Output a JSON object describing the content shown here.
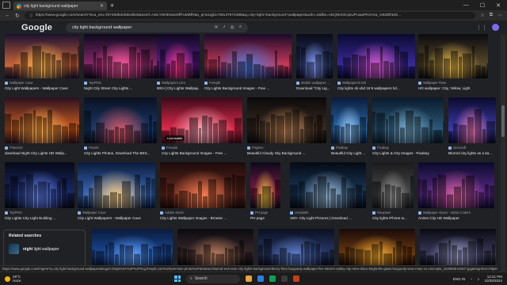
{
  "browser": {
    "tab_title": "city light background wallpaper",
    "url": "https://www.google.com/search?sca_esv=f5749d53eb8ed946&sxsrf=ADLYWIIK6we5ffTuMBfN5a_qHx1qjk1738137874485&q=city+light+background+wallpaper&udm=2&fbs=AEQNm0CqsUPuwaPKrHXa_U82Dlf4dS..."
  },
  "google": {
    "logo": "Google",
    "query": "city light background wallpaper"
  },
  "results": [
    {
      "source": "Wallpaper Cave",
      "caption": "City Light Wallpapers - Wallpaper Cave",
      "colors": [
        "#1a1030",
        "#c8643a",
        "#f7b44c"
      ]
    },
    {
      "source": "TopPNG",
      "caption": "Night City Street City Lights ...",
      "colors": [
        "#0c0a1e",
        "#8a2a6a",
        "#ff5aa0"
      ]
    },
    {
      "source": "Wallpapers.com",
      "caption": "900+] City Lights Wallpap...",
      "colors": [
        "#100820",
        "#5a1f8a",
        "#ff3a8a"
      ]
    },
    {
      "source": "Freepik",
      "caption": "City Lights Background Images - Free ...",
      "colors": [
        "#1a0a2a",
        "#c83a5a",
        "#4a7adf"
      ]
    },
    {
      "source": "Mobile wallpaper ...",
      "caption": "Download \"City Lig...",
      "colors": [
        "#0a0a18",
        "#2a3a6a",
        "#8aa0ff"
      ]
    },
    {
      "source": "WallpapersCraft",
      "caption": "City lights 4k uhd 16:9 wallpapers hd...",
      "colors": [
        "#0a0a30",
        "#3a2a9a",
        "#e05ad0"
      ]
    },
    {
      "source": "Wallpaper Flare",
      "caption": "HD wallpaper: City, Yellow, Light",
      "colors": [
        "#0a0a10",
        "#5a4a2a",
        "#f0c050"
      ]
    },
    {
      "source": "Pinterest",
      "caption": "download Night City Lights HD Wallp...",
      "colors": [
        "#2a1020",
        "#d06020",
        "#ffb050"
      ]
    },
    {
      "source": "Pexels",
      "caption": "City Lights Photos, Download The BES...",
      "colors": [
        "#0a1020",
        "#1a3a6a",
        "#e05a6a"
      ]
    },
    {
      "source": "Freepik",
      "caption": "City Lights Background Images - Free ...",
      "colors": [
        "#3a0a1a",
        "#e02a4a",
        "#ffb0c0"
      ]
    },
    {
      "source": "Pngtree",
      "caption": "Beautiful Cloudy Sky Background ...",
      "colors": [
        "#0a0a0a",
        "#3a2a20",
        "#d09060"
      ]
    },
    {
      "source": "Pixabay",
      "caption": "Beautiful City Light ...",
      "colors": [
        "#0a1a3a",
        "#2a6aaa",
        "#a0d0ff"
      ]
    },
    {
      "source": "Pixabay",
      "caption": "City Lights & City Images - Pixabay",
      "colors": [
        "#0a1a2a",
        "#2a5a7a",
        "#7ab0d0"
      ]
    },
    {
      "source": "Gencraft",
      "caption": "Blurred city lights as a ba...",
      "colors": [
        "#0a0a2a",
        "#3a3aaa",
        "#ff80c0"
      ]
    },
    {
      "source": "TopPNG",
      "caption": "City Lights City Light Building ...",
      "colors": [
        "#060a18",
        "#1a2a6a",
        "#6a8aff"
      ]
    },
    {
      "source": "Wallpaper Cave",
      "caption": "City Light Wallpapers - Wallpaper Cave",
      "colors": [
        "#0a1a3a",
        "#3a6aba",
        "#ffd080"
      ]
    },
    {
      "source": "Adobe Stock",
      "caption": "City Lights Wallpaper Images - Browse ...",
      "colors": [
        "#1a0a0a",
        "#6a2a20",
        "#ff8050"
      ]
    },
    {
      "source": "PH page",
      "caption": "PH page",
      "colors": [
        "#0a0a1a",
        "#8a1a4a",
        "#ffd040"
      ]
    },
    {
      "source": "Unsplash",
      "caption": "100+ City Light Pictures | Download ...",
      "colors": [
        "#050a14",
        "#1a3a5a",
        "#a0c0e0"
      ]
    },
    {
      "source": "Rawpixel",
      "caption": "City lights iPhone w...",
      "colors": [
        "#1a1a1a",
        "#4a4a4a",
        "#a0a0a0"
      ]
    },
    {
      "source": "Wallpaper Abyss - Alpha Coders",
      "caption": "Anime City HD Wallpaper",
      "colors": [
        "#0a0a2a",
        "#5a2a8a",
        "#e060a0"
      ]
    },
    {
      "source": "",
      "caption": "",
      "colors": [
        "#0a1a3a",
        "#1a4a9a",
        "#60a0ff"
      ]
    },
    {
      "source": "",
      "caption": "",
      "colors": [
        "#0a0a10",
        "#3a2a2a",
        "#c08060"
      ]
    },
    {
      "source": "",
      "caption": "",
      "colors": [
        "#0a1020",
        "#2a3a6a",
        "#6080d0"
      ]
    },
    {
      "source": "",
      "caption": "",
      "colors": [
        "#1a0a0a",
        "#6a3a10",
        "#ffb030"
      ]
    },
    {
      "source": "",
      "caption": "",
      "colors": [
        "#0a0a14",
        "#3a3a5a",
        "#a0a0d0"
      ]
    }
  ],
  "licensable_label": "Licensable",
  "related": {
    "title": "Related searches",
    "item_bold": "night",
    "item_rest": " light wallpaper"
  },
  "status_url": "https://www.google.com/imgres?q=city light background wallpaper&imgurl=https%3A%2F%2Fimg.freepik.com%2Fpremium-photo%2Fabstract-blurred-red-neon-city-lights-background-blurry-fiery-burgundy-wallpaper-fire-electric-safety-city-retro-disco-bright-life-glass-burgundy-wow-mary-co-concepts_1029938-52347.jpg&imgrefurl=https%3A%2F%2F...",
  "taskbar": {
    "temp": "29°C",
    "weather": "Haze",
    "search_placeholder": "Search",
    "lang": "ENG IN",
    "time": "12:21 PM",
    "date": "10/26/2024"
  }
}
